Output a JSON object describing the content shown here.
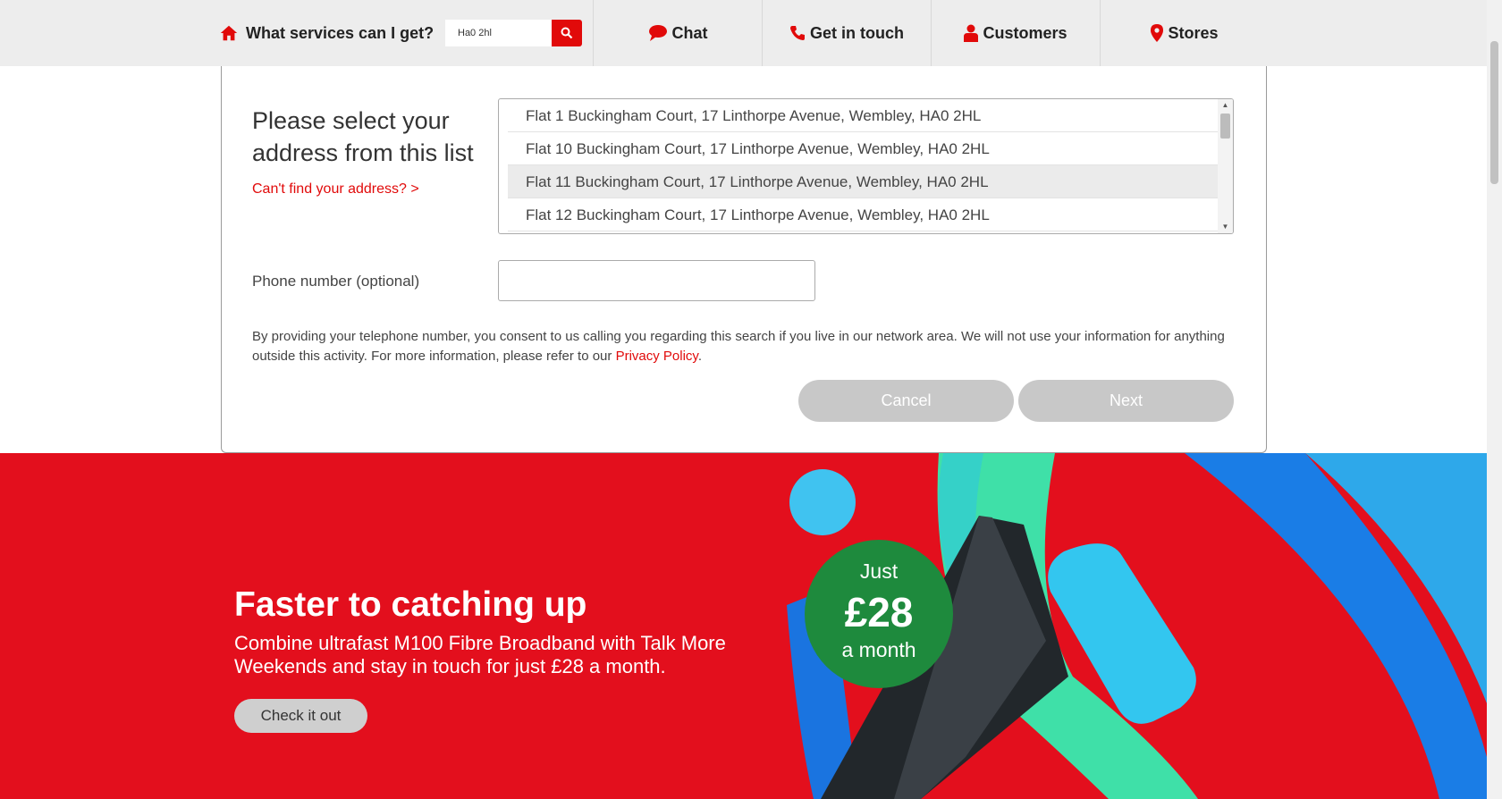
{
  "nav": {
    "services_label": "What services can I get?",
    "search_value": "Ha0 2hl",
    "chat": "Chat",
    "get_in_touch": "Get in touch",
    "customers": "Customers",
    "stores": "Stores"
  },
  "form": {
    "title": "Please select your address from this list",
    "cant_find": "Can't find your address? >",
    "addresses": [
      "Flat 1 Buckingham Court, 17 Linthorpe Avenue, Wembley, HA0 2HL",
      "Flat 10 Buckingham Court, 17 Linthorpe Avenue, Wembley, HA0 2HL",
      "Flat 11 Buckingham Court, 17 Linthorpe Avenue, Wembley, HA0 2HL",
      "Flat 12 Buckingham Court, 17 Linthorpe Avenue, Wembley, HA0 2HL"
    ],
    "selected_address": "Flat 11 Buckingham Court, 17 Linthorpe Avenue, Wembley, HA0 2HL",
    "phone_label": "Phone number (optional)",
    "phone_value": "",
    "consent_text": "By providing your telephone number, you consent to us calling you regarding this search if you live in our network area. We will not use your information for anything outside this activity. For more information, please refer to our ",
    "privacy_link": "Privacy Policy",
    "consent_end": ".",
    "cancel": "Cancel",
    "next": "Next"
  },
  "promo": {
    "title": "Faster to catching up",
    "subtitle": "Combine ultrafast M100 Fibre Broadband with Talk More Weekends and stay in touch for just £28 a month.",
    "button": "Check it out",
    "badge_just": "Just",
    "badge_price": "£28",
    "badge_month": "a month"
  },
  "colors": {
    "brand_red": "#e10a0a",
    "promo_red": "#e30f1d",
    "badge_green": "#1e8a3d",
    "button_grey": "#c8c8c8"
  }
}
